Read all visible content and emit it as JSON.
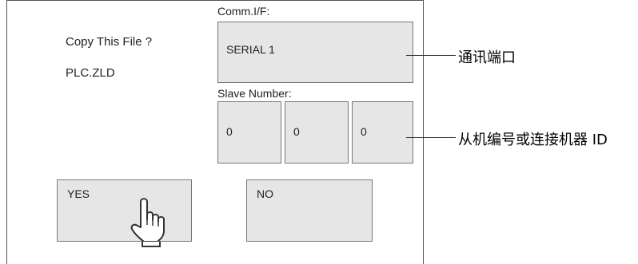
{
  "dialog": {
    "prompt": "Copy This File ?",
    "filename": "PLC.ZLD",
    "comm_label": "Comm.I/F:",
    "comm_value": "SERIAL  1",
    "slave_label": "Slave Number:",
    "slave_values": [
      "0",
      "0",
      "0"
    ],
    "yes_label": "YES",
    "no_label": "NO"
  },
  "annotations": {
    "comm_port": "通讯端口",
    "slave_id": "从机编号或连接机器 ID"
  },
  "icons": {
    "pointer": "hand-pointer-icon"
  },
  "colors": {
    "button_bg": "#e6e6e6",
    "border": "#777777"
  }
}
